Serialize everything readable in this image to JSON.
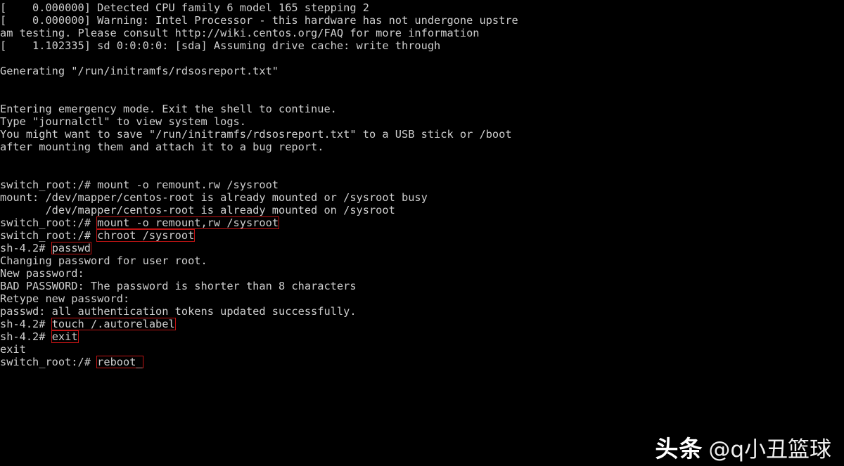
{
  "terminal": {
    "background_color": "#000000",
    "text_color": "#cfcfcf",
    "highlight_color": "#c01414",
    "lines": [
      {
        "id": "l1",
        "text": "[    0.000000] Detected CPU family 6 model 165 stepping 2"
      },
      {
        "id": "l2",
        "text": "[    0.000000] Warning: Intel Processor - this hardware has not undergone upstre"
      },
      {
        "id": "l3",
        "text": "am testing. Please consult http://wiki.centos.org/FAQ for more information"
      },
      {
        "id": "l4",
        "text": "[    1.102335] sd 0:0:0:0: [sda] Assuming drive cache: write through"
      },
      {
        "id": "l5",
        "text": ""
      },
      {
        "id": "l6",
        "text": "Generating \"/run/initramfs/rdsosreport.txt\""
      },
      {
        "id": "l7",
        "text": ""
      },
      {
        "id": "l8",
        "text": ""
      },
      {
        "id": "l9",
        "text": "Entering emergency mode. Exit the shell to continue."
      },
      {
        "id": "l10",
        "text": "Type \"journalctl\" to view system logs."
      },
      {
        "id": "l11",
        "text": "You might want to save \"/run/initramfs/rdsosreport.txt\" to a USB stick or /boot"
      },
      {
        "id": "l12",
        "text": "after mounting them and attach it to a bug report."
      },
      {
        "id": "l13",
        "text": ""
      },
      {
        "id": "l14",
        "text": ""
      },
      {
        "id": "l15",
        "text": "switch_root:/# mount -o remount.rw /sysroot"
      },
      {
        "id": "l16",
        "text": "mount: /dev/mapper/centos-root is already mounted or /sysroot busy"
      },
      {
        "id": "l17",
        "text": "       /dev/mapper/centos-root is already mounted on /sysroot"
      },
      {
        "id": "l18",
        "prompt": "switch_root:/# ",
        "command": "mount -o remount,rw /sysroot",
        "boxed": true
      },
      {
        "id": "l19",
        "prompt": "switch_root:/# ",
        "command": "chroot /sysroot",
        "boxed": true
      },
      {
        "id": "l20",
        "prompt": "sh-4.2# ",
        "command": "passwd",
        "boxed": true
      },
      {
        "id": "l21",
        "text": "Changing password for user root."
      },
      {
        "id": "l22",
        "text": "New password:"
      },
      {
        "id": "l23",
        "text": "BAD PASSWORD: The password is shorter than 8 characters"
      },
      {
        "id": "l24",
        "text": "Retype new password:"
      },
      {
        "id": "l25",
        "text": "passwd: all authentication tokens updated successfully."
      },
      {
        "id": "l26",
        "prompt": "sh-4.2# ",
        "command": "touch /.autorelabel",
        "boxed": true
      },
      {
        "id": "l27",
        "prompt": "sh-4.2# ",
        "command": "exit",
        "boxed": true
      },
      {
        "id": "l28",
        "text": "exit"
      },
      {
        "id": "l29",
        "prompt": "switch_root:/# ",
        "command": "reboot_",
        "boxed": true
      }
    ]
  },
  "watermark": {
    "brand": "头条",
    "handle": "@q小丑篮球"
  }
}
